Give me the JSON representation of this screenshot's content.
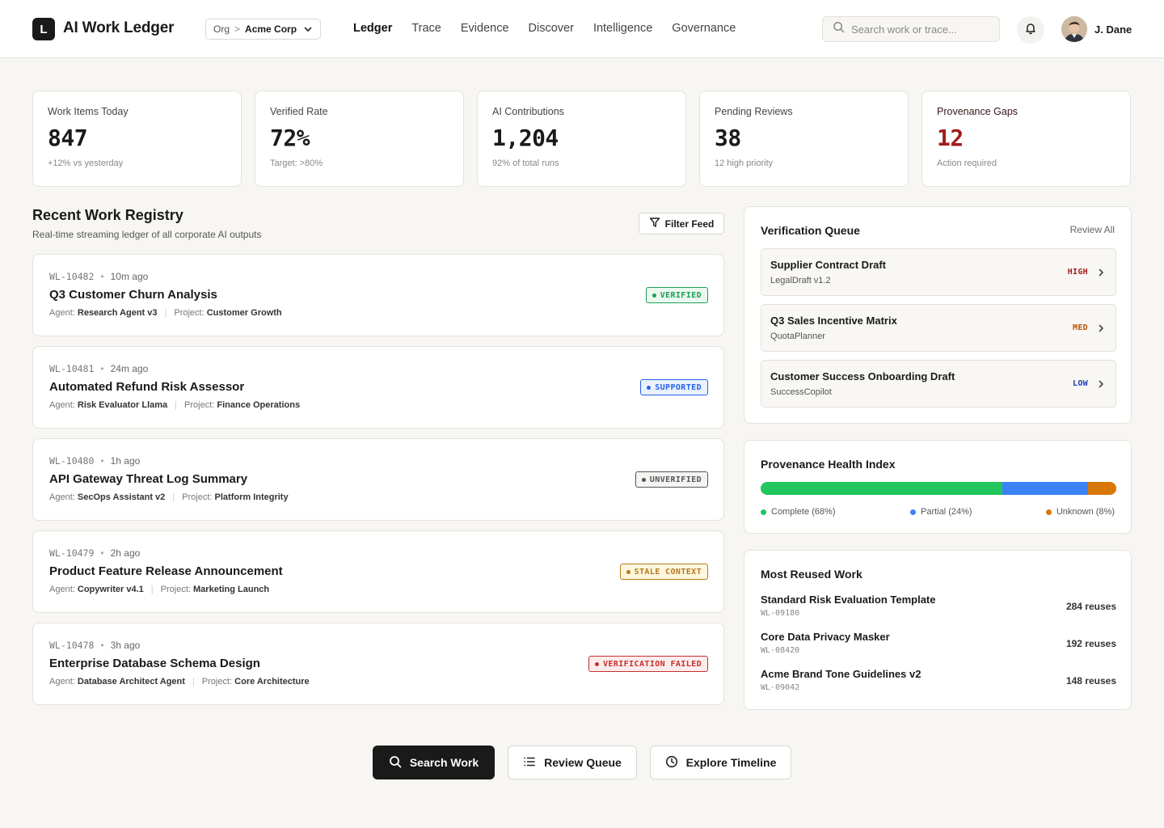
{
  "header": {
    "logo_letter": "L",
    "app_title": "AI Work Ledger",
    "org_label": "Org",
    "org_separator": ">",
    "org_name": "Acme Corp",
    "nav": [
      "Ledger",
      "Trace",
      "Evidence",
      "Discover",
      "Intelligence",
      "Governance"
    ],
    "active_nav": "Ledger",
    "search_placeholder": "Search work or trace...",
    "user_name": "J. Dane"
  },
  "stats": [
    {
      "label": "Work Items Today",
      "value": "847",
      "sub": "+12% vs yesterday",
      "danger": false
    },
    {
      "label": "Verified Rate",
      "value": "72%",
      "sub": "Target: >80%",
      "danger": false
    },
    {
      "label": "AI Contributions",
      "value": "1,204",
      "sub": "92% of total runs",
      "danger": false
    },
    {
      "label": "Pending Reviews",
      "value": "38",
      "sub": "12 high priority",
      "danger": false
    },
    {
      "label": "Provenance Gaps",
      "value": "12",
      "sub": "Action required",
      "danger": true
    }
  ],
  "registry": {
    "title": "Recent Work Registry",
    "subtitle": "Real-time streaming ledger of all corporate AI outputs",
    "filter_label": "Filter Feed",
    "agent_label": "Agent:",
    "project_label": "Project:",
    "items": [
      {
        "id": "WL-10482",
        "time": "10m ago",
        "title": "Q3 Customer Churn Analysis",
        "agent": "Research Agent v3",
        "project": "Customer Growth",
        "status": "VERIFIED",
        "status_color": "#1f9d55",
        "status_bg": "#eaf8ef"
      },
      {
        "id": "WL-10481",
        "time": "24m ago",
        "title": "Automated Refund Risk Assessor",
        "agent": "Risk Evaluator Llama",
        "project": "Finance Operations",
        "status": "SUPPORTED",
        "status_color": "#2563eb",
        "status_bg": "#eaf1fd"
      },
      {
        "id": "WL-10480",
        "time": "1h ago",
        "title": "API Gateway Threat Log Summary",
        "agent": "SecOps Assistant v2",
        "project": "Platform Integrity",
        "status": "UNVERIFIED",
        "status_color": "#555555",
        "status_bg": "#f4f4f2"
      },
      {
        "id": "WL-10479",
        "time": "2h ago",
        "title": "Product Feature Release Announcement",
        "agent": "Copywriter v4.1",
        "project": "Marketing Launch",
        "status": "STALE CONTEXT",
        "status_color": "#b7791f",
        "status_bg": "#fdf6dc"
      },
      {
        "id": "WL-10478",
        "time": "3h ago",
        "title": "Enterprise Database Schema Design",
        "agent": "Database Architect Agent",
        "project": "Core Architecture",
        "status": "VERIFICATION FAILED",
        "status_color": "#c53030",
        "status_bg": "#fdecec"
      }
    ]
  },
  "verification_queue": {
    "title": "Verification Queue",
    "review_all": "Review All",
    "items": [
      {
        "title": "Supplier Contract Draft",
        "source": "LegalDraft v1.2",
        "priority": "HIGH",
        "priority_color": "#a11b1b"
      },
      {
        "title": "Q3 Sales Incentive Matrix",
        "source": "QuotaPlanner",
        "priority": "MED",
        "priority_color": "#b45309"
      },
      {
        "title": "Customer Success Onboarding Draft",
        "source": "SuccessCopilot",
        "priority": "LOW",
        "priority_color": "#1e40af"
      }
    ]
  },
  "provenance_health": {
    "title": "Provenance Health Index",
    "segments": [
      {
        "label": "Complete (68%)",
        "value": 68,
        "color": "#22c55e"
      },
      {
        "label": "Partial (24%)",
        "value": 24,
        "color": "#3b82f6"
      },
      {
        "label": "Unknown (8%)",
        "value": 8,
        "color": "#d97706"
      }
    ]
  },
  "most_reused": {
    "title": "Most Reused Work",
    "items": [
      {
        "title": "Standard Risk Evaluation Template",
        "id": "WL-09180",
        "count": "284 reuses"
      },
      {
        "title": "Core Data Privacy Masker",
        "id": "WL-08420",
        "count": "192 reuses"
      },
      {
        "title": "Acme Brand Tone Guidelines v2",
        "id": "WL-09042",
        "count": "148 reuses"
      }
    ]
  },
  "actions": {
    "search_work": "Search Work",
    "review_queue": "Review Queue",
    "explore_timeline": "Explore Timeline"
  }
}
